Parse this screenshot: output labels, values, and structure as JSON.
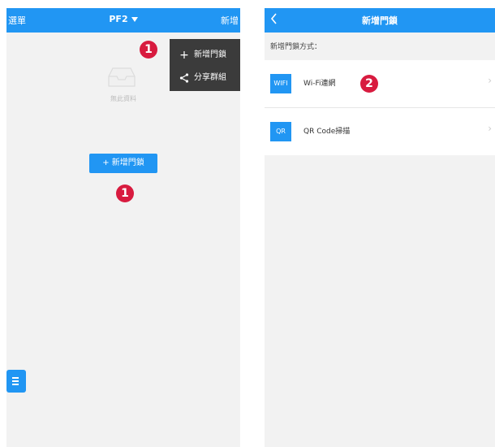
{
  "left_screen": {
    "nav": {
      "menu_label": "選單",
      "title": "PF2",
      "add_label": "新增"
    },
    "empty_state": {
      "icon": "inbox-icon",
      "text": "無此資料"
    },
    "add_button": {
      "label": "+ 新增門鎖"
    },
    "dropdown_menu": [
      {
        "icon": "plus-icon",
        "glyph": "+",
        "label": "新增門鎖"
      },
      {
        "icon": "share-icon",
        "glyph": "‹",
        "label": "分享群組"
      }
    ],
    "badges": {
      "menu": "1",
      "button": "1"
    },
    "float_button": {
      "icon": "menu-icon"
    }
  },
  "right_screen": {
    "nav": {
      "back_icon": "back-icon",
      "title": "新增門鎖"
    },
    "section_label": "新增門鎖方式：",
    "methods": [
      {
        "tag": "WIFI",
        "label": "Wi-Fi連網",
        "chevron": "›"
      },
      {
        "tag": "QR",
        "label": "QR Code掃描",
        "chevron": "›"
      }
    ],
    "badge": "2"
  },
  "colors": {
    "accent": "#2196f3",
    "menu_bg": "#3b3b3b",
    "badge": "#d81b3f",
    "screen_bg": "#f2f2f2"
  }
}
